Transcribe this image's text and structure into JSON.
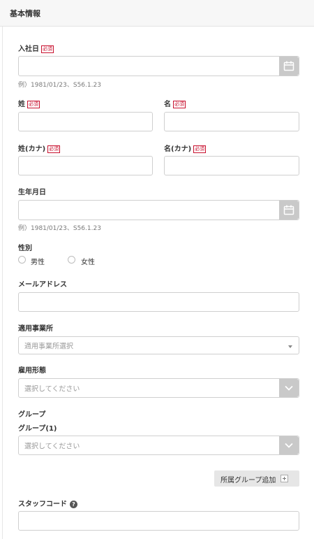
{
  "header": {
    "title": "基本情報"
  },
  "required_label": "必須",
  "fields": {
    "hire_date": {
      "label": "入社日",
      "hint": "例）1981/01/23、S56.1.23",
      "value": ""
    },
    "last_name": {
      "label": "姓",
      "value": ""
    },
    "first_name": {
      "label": "名",
      "value": ""
    },
    "last_name_kana": {
      "label": "姓(カナ)",
      "value": ""
    },
    "first_name_kana": {
      "label": "名(カナ)",
      "value": ""
    },
    "birth_date": {
      "label": "生年月日",
      "hint": "例）1981/01/23、S56.1.23",
      "value": ""
    },
    "gender": {
      "label": "性別",
      "options": [
        "男性",
        "女性"
      ]
    },
    "email": {
      "label": "メールアドレス",
      "value": ""
    },
    "office": {
      "label": "適用事業所",
      "placeholder": "適用事業所選択"
    },
    "employment_type": {
      "label": "雇用形態",
      "placeholder": "選択してください"
    },
    "group": {
      "label": "グループ",
      "sub_label": "グループ(1)",
      "placeholder": "選択してください"
    },
    "add_group_button": "所属グループ追加",
    "staff_code": {
      "label": "スタッフコード",
      "help_icon": "?",
      "value": ""
    }
  },
  "icons": {
    "calendar": "calendar-icon",
    "chevron": "chevron-down-icon",
    "plus": "plus-icon",
    "help": "question-circle-icon"
  },
  "colors": {
    "required": "#c8102e",
    "button_gray": "#c9c9c9",
    "header_bg": "#f7f7f7"
  }
}
